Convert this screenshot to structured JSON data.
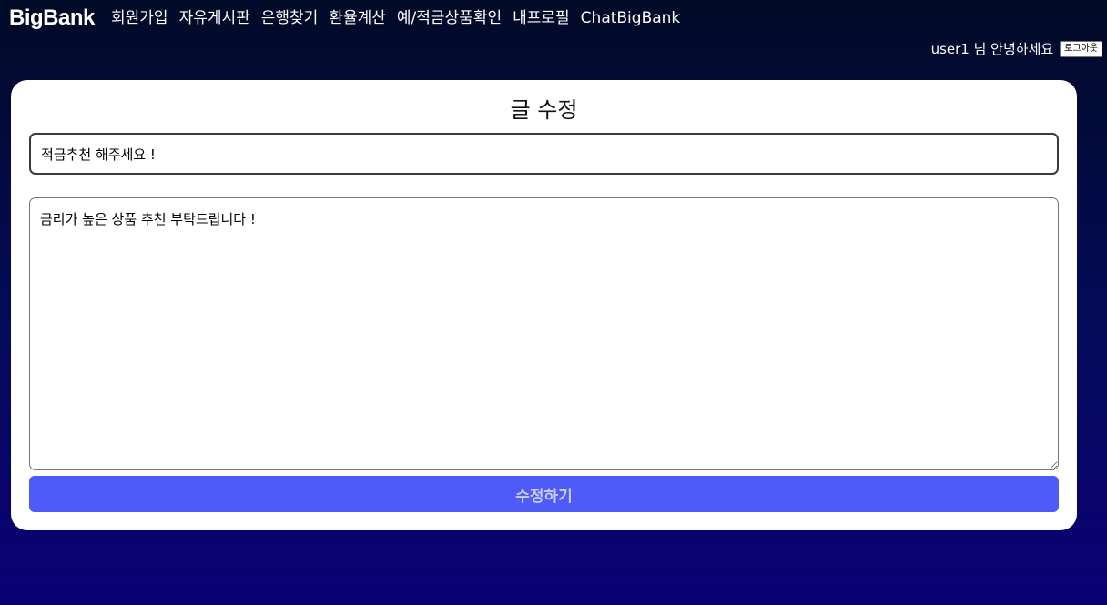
{
  "header": {
    "logo": "BigBank",
    "nav": [
      {
        "label": "회원가입"
      },
      {
        "label": "자유게시판"
      },
      {
        "label": "은행찾기"
      },
      {
        "label": "환율계산"
      },
      {
        "label": "예/적금상품확인"
      },
      {
        "label": "내프로필"
      },
      {
        "label": "ChatBigBank"
      }
    ],
    "greeting": "user1 님 안녕하세요",
    "logout_label": "로그아웃"
  },
  "edit_form": {
    "heading": "글 수정",
    "title_value": "적금추천 해주세요 !",
    "content_value": "금리가 높은 상품 추천 부탁드립니다 !",
    "submit_label": "수정하기"
  }
}
